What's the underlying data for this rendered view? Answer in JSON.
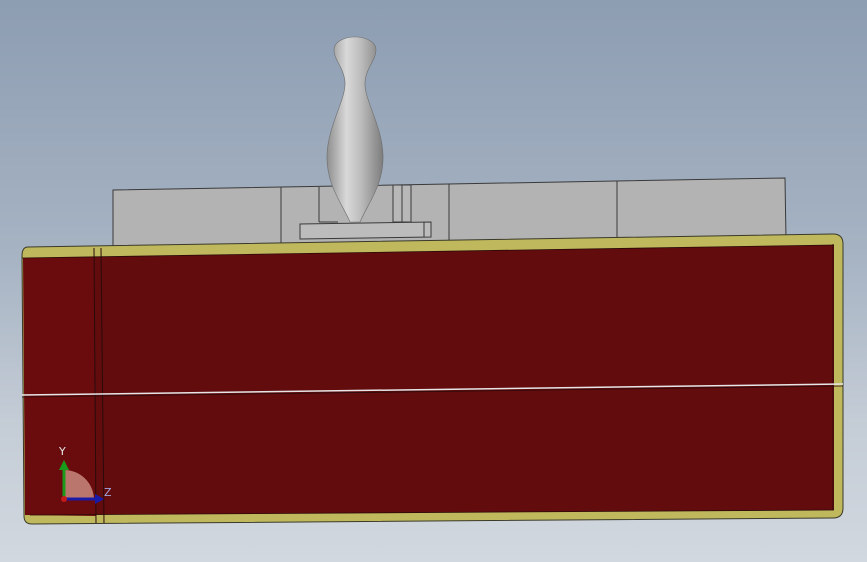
{
  "viewport": {
    "background_top": "#8d9db2",
    "background_bottom": "#d2d8df"
  },
  "model": {
    "body_color": "#620c0e",
    "edge_color": "#c0b85c",
    "fixture_color": "#b4b4b4",
    "part_color": "#b8b8b8"
  },
  "triad": {
    "y_label": "Y",
    "z_label": "Z",
    "y_color": "#1a9a1a",
    "z_color": "#1a1aa8",
    "x_color": "#c41a1a"
  }
}
